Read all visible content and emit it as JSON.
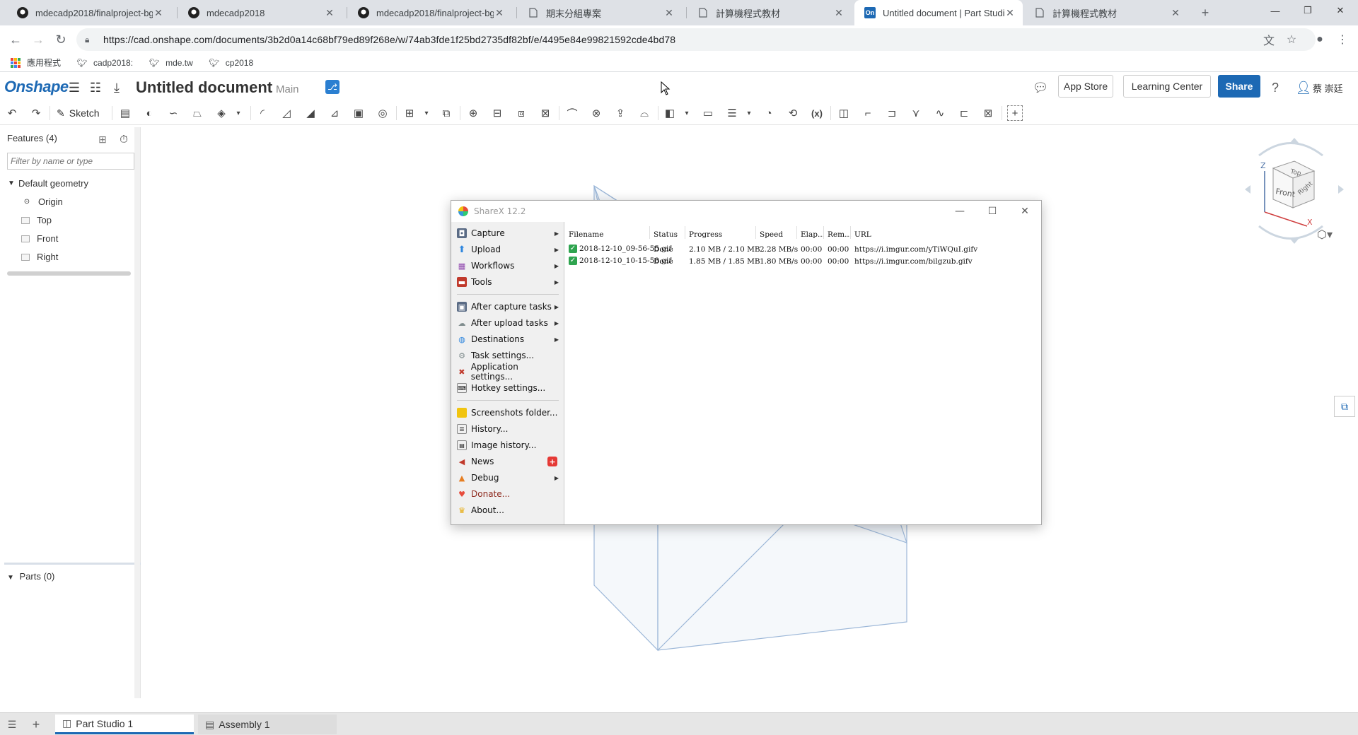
{
  "browser": {
    "tabs": [
      {
        "title": "mdecadp2018/finalproject-bg",
        "favicon": "github-icon"
      },
      {
        "title": "mdecadp2018",
        "favicon": "github-icon"
      },
      {
        "title": "mdecadp2018/finalproject-bg",
        "favicon": "github-icon"
      },
      {
        "title": "期末分組專案",
        "favicon": "page-icon"
      },
      {
        "title": "計算機程式教材",
        "favicon": "page-icon"
      },
      {
        "title": "Untitled document | Part Studio",
        "favicon": "onshape-icon",
        "active": true
      },
      {
        "title": "計算機程式教材",
        "favicon": "page-icon"
      }
    ],
    "url": "https://cad.onshape.com/documents/3b2d0a14c68bf79ed89f268e/w/74ab3fde1f25bd2735df82bf/e/4495e84e99821592cde4bd78",
    "bookmarks": [
      "應用程式",
      "cadp2018:",
      "mde.tw",
      "cp2018"
    ]
  },
  "onshape": {
    "logo": "Onshape",
    "doc_title": "Untitled document",
    "branch": "Main",
    "app_store": "App Store",
    "learning_center": "Learning Center",
    "share": "Share",
    "user": "蔡 崇廷",
    "sketch_label": "Sketch",
    "features_header": "Features (4)",
    "filter_placeholder": "Filter by name or type",
    "default_geometry": "Default geometry",
    "tree": [
      "Origin",
      "Top",
      "Front",
      "Right"
    ],
    "parts": "Parts (0)",
    "bottom_tabs": [
      "Part Studio 1",
      "Assembly 1"
    ],
    "viewcube": {
      "top": "Top",
      "front": "Front",
      "right": "Right",
      "x": "X",
      "z": "Z"
    },
    "accent": "#1d69b4"
  },
  "sharex": {
    "title": "ShareX 12.2",
    "menu": [
      {
        "label": "Capture",
        "icon": "camera-icon",
        "arrow": true
      },
      {
        "label": "Upload",
        "icon": "upload-icon",
        "arrow": true
      },
      {
        "label": "Workflows",
        "icon": "workflow-icon",
        "arrow": true
      },
      {
        "label": "Tools",
        "icon": "toolbox-icon",
        "arrow": true
      },
      {
        "label": "After capture tasks",
        "icon": "after-capture-icon",
        "arrow": true
      },
      {
        "label": "After upload tasks",
        "icon": "after-upload-icon",
        "arrow": true
      },
      {
        "label": "Destinations",
        "icon": "globe-icon",
        "arrow": true
      },
      {
        "label": "Task settings...",
        "icon": "gear-icon",
        "arrow": false
      },
      {
        "label": "Application settings...",
        "icon": "wrench-icon",
        "arrow": false
      },
      {
        "label": "Hotkey settings...",
        "icon": "keyboard-icon",
        "arrow": false
      },
      {
        "label": "Screenshots folder...",
        "icon": "folder-icon",
        "arrow": false
      },
      {
        "label": "History...",
        "icon": "history-icon",
        "arrow": false
      },
      {
        "label": "Image history...",
        "icon": "image-history-icon",
        "arrow": false
      },
      {
        "label": "News",
        "icon": "megaphone-icon",
        "arrow": false,
        "badge": "+"
      },
      {
        "label": "Debug",
        "icon": "debug-icon",
        "arrow": true
      },
      {
        "label": "Donate...",
        "icon": "heart-icon",
        "arrow": false
      },
      {
        "label": "About...",
        "icon": "crown-icon",
        "arrow": false
      }
    ],
    "columns": [
      "Filename",
      "Status",
      "Progress",
      "Speed",
      "Elap...",
      "Rem...",
      "URL"
    ],
    "rows": [
      {
        "filename": "2018-12-10_09-56-55.gif",
        "status": "Done",
        "progress": "2.10 MB / 2.10 MB",
        "speed": "2.28 MB/s",
        "elapsed": "00:00",
        "remaining": "00:00",
        "url": "https://i.imgur.com/yTiWQuI.gifv"
      },
      {
        "filename": "2018-12-10_10-15-58.gif",
        "status": "Done",
        "progress": "1.85 MB / 1.85 MB",
        "speed": "1.80 MB/s",
        "elapsed": "00:00",
        "remaining": "00:00",
        "url": "https://i.imgur.com/bilgzub.gifv"
      }
    ]
  }
}
